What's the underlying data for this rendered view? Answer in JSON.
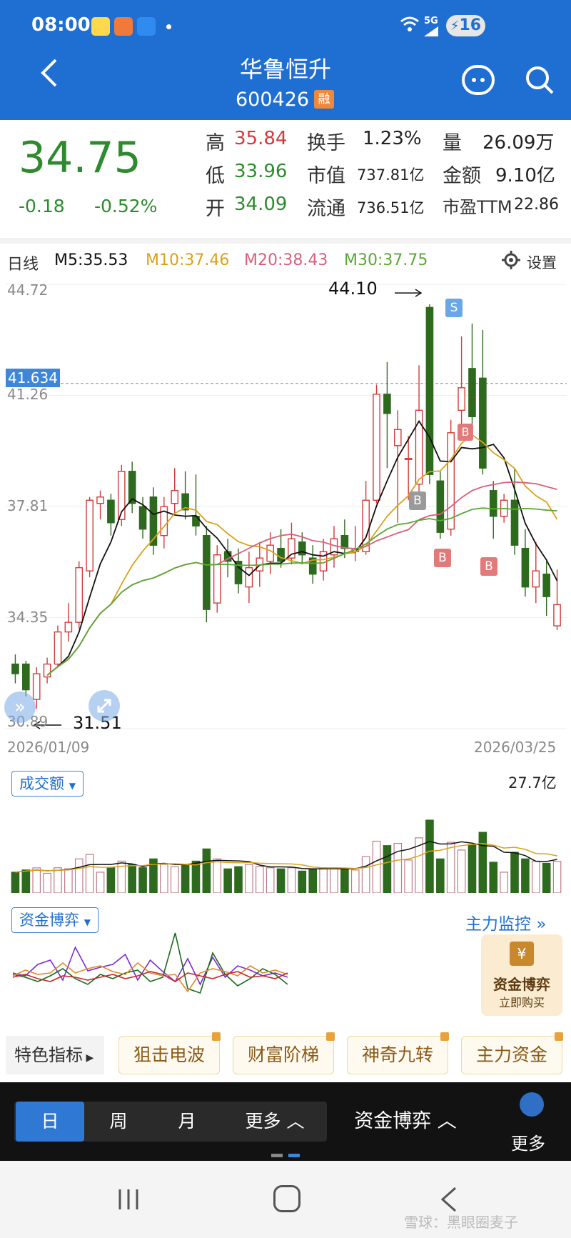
{
  "status_bar": {
    "time": "08:00",
    "network": "5G",
    "battery": "16"
  },
  "header": {
    "title": "华鲁恒升",
    "code": "600426",
    "badge": "融"
  },
  "quote": {
    "price": "34.75",
    "change": "-0.18",
    "change_pct": "-0.52%",
    "high_label": "高",
    "high": "35.84",
    "low_label": "低",
    "low": "33.96",
    "open_label": "开",
    "open": "34.09",
    "turnover_label": "换手",
    "turnover": "1.23%",
    "mktcap_label": "市值",
    "mktcap": "737.81亿",
    "float_label": "流通",
    "float": "736.51亿",
    "volume_label": "量",
    "volume": "26.09万",
    "amount_label": "金额",
    "amount": "9.10亿",
    "pe_label": "市盈TTM",
    "pe": "22.86"
  },
  "ma_legend": {
    "period": "日线",
    "m5": "M5:35.53",
    "m10": "M10:37.46",
    "m20": "M20:38.43",
    "m30": "M30:37.75",
    "settings": "设置"
  },
  "colors": {
    "up": "#d23b3b",
    "down": "#2e6a1e",
    "m5": "#111111",
    "m10": "#d9a21a",
    "m20": "#d9607a",
    "m30": "#5aa834",
    "accent": "#1f6fd2"
  },
  "price_axis": {
    "top": "44.72",
    "mid1": "41.26",
    "mid2": "37.81",
    "mid3": "34.35",
    "bottom": "30.89"
  },
  "crosshair_value": "41.634",
  "annotations": {
    "high": "44.10",
    "low": "31.51"
  },
  "signals": {
    "s": "S",
    "b": "B"
  },
  "dates": {
    "start": "2026/01/09",
    "end": "2026/03/25"
  },
  "volume_panel": {
    "selector": "成交额",
    "max": "27.7亿"
  },
  "flow_panel": {
    "selector": "资金博弈",
    "link": "主力监控",
    "promo_title": "资金博弈",
    "promo_cta": "立即购买"
  },
  "indicators": {
    "label": "特色指标",
    "items": [
      "狙击电波",
      "财富阶梯",
      "神奇九转",
      "主力资金"
    ]
  },
  "bottom_tabs": {
    "day": "日",
    "week": "周",
    "month": "月",
    "more": "更多",
    "flow": "资金博弈",
    "menu_more": "更多"
  },
  "watermark": "雪球：黑眼圈麦子",
  "chart_data": {
    "type": "candlestick",
    "ylim": [
      30.89,
      44.72
    ],
    "candles": [
      {
        "o": 32.9,
        "c": 32.6,
        "h": 33.2,
        "l": 32.3
      },
      {
        "o": 32.9,
        "c": 32.1,
        "h": 33.0,
        "l": 31.9
      },
      {
        "o": 31.8,
        "c": 32.6,
        "h": 32.8,
        "l": 31.51
      },
      {
        "o": 32.5,
        "c": 32.9,
        "h": 33.1,
        "l": 32.3
      },
      {
        "o": 32.9,
        "c": 33.9,
        "h": 34.1,
        "l": 32.8
      },
      {
        "o": 33.9,
        "c": 34.2,
        "h": 34.8,
        "l": 33.6
      },
      {
        "o": 34.2,
        "c": 35.9,
        "h": 36.1,
        "l": 34.0
      },
      {
        "o": 35.8,
        "c": 38.0,
        "h": 38.1,
        "l": 35.6
      },
      {
        "o": 37.9,
        "c": 38.1,
        "h": 38.3,
        "l": 37.4
      },
      {
        "o": 38.0,
        "c": 37.3,
        "h": 38.2,
        "l": 36.9
      },
      {
        "o": 37.4,
        "c": 38.9,
        "h": 39.1,
        "l": 37.2
      },
      {
        "o": 38.9,
        "c": 37.9,
        "h": 39.2,
        "l": 37.6
      },
      {
        "o": 37.8,
        "c": 37.1,
        "h": 38.1,
        "l": 36.8
      },
      {
        "o": 38.1,
        "c": 36.6,
        "h": 38.4,
        "l": 36.3
      },
      {
        "o": 36.9,
        "c": 37.8,
        "h": 38.1,
        "l": 36.5
      },
      {
        "o": 37.9,
        "c": 38.3,
        "h": 39.0,
        "l": 37.6
      },
      {
        "o": 38.2,
        "c": 37.7,
        "h": 38.9,
        "l": 37.4
      },
      {
        "o": 37.5,
        "c": 37.2,
        "h": 38.8,
        "l": 36.9
      },
      {
        "o": 36.9,
        "c": 34.6,
        "h": 37.2,
        "l": 34.2
      },
      {
        "o": 34.8,
        "c": 36.3,
        "h": 36.6,
        "l": 34.5
      },
      {
        "o": 36.4,
        "c": 36.1,
        "h": 36.8,
        "l": 35.6
      },
      {
        "o": 36.1,
        "c": 35.4,
        "h": 36.5,
        "l": 35.1
      },
      {
        "o": 35.3,
        "c": 35.9,
        "h": 36.4,
        "l": 34.8
      },
      {
        "o": 35.8,
        "c": 36.2,
        "h": 36.7,
        "l": 35.3
      },
      {
        "o": 36.1,
        "c": 36.6,
        "h": 37.0,
        "l": 35.7
      },
      {
        "o": 36.5,
        "c": 36.1,
        "h": 37.1,
        "l": 35.9
      },
      {
        "o": 36.2,
        "c": 36.8,
        "h": 37.3,
        "l": 36.0
      },
      {
        "o": 36.7,
        "c": 36.3,
        "h": 37.0,
        "l": 36.0
      },
      {
        "o": 36.2,
        "c": 35.7,
        "h": 36.6,
        "l": 35.4
      },
      {
        "o": 35.8,
        "c": 36.4,
        "h": 36.8,
        "l": 35.5
      },
      {
        "o": 36.3,
        "c": 36.8,
        "h": 37.2,
        "l": 35.9
      },
      {
        "o": 36.9,
        "c": 36.5,
        "h": 37.4,
        "l": 36.2
      },
      {
        "o": 36.4,
        "c": 36.5,
        "h": 37.2,
        "l": 36.1
      },
      {
        "o": 36.4,
        "c": 38.0,
        "h": 38.6,
        "l": 36.3
      },
      {
        "o": 38.0,
        "c": 41.3,
        "h": 41.6,
        "l": 37.9
      },
      {
        "o": 41.3,
        "c": 40.7,
        "h": 42.3,
        "l": 39.0
      },
      {
        "o": 39.7,
        "c": 40.2,
        "h": 40.8,
        "l": 37.3
      },
      {
        "o": 39.3,
        "c": 39.3,
        "h": 40.0,
        "l": 38.0
      },
      {
        "o": 38.5,
        "c": 40.8,
        "h": 42.2,
        "l": 38.2
      },
      {
        "o": 44.0,
        "c": 38.8,
        "h": 44.1,
        "l": 38.5
      },
      {
        "o": 38.6,
        "c": 37.0,
        "h": 38.9,
        "l": 36.8
      },
      {
        "o": 37.1,
        "c": 40.1,
        "h": 40.5,
        "l": 36.9
      },
      {
        "o": 40.8,
        "c": 41.5,
        "h": 43.1,
        "l": 40.2
      },
      {
        "o": 42.1,
        "c": 40.6,
        "h": 43.5,
        "l": 40.1
      },
      {
        "o": 41.8,
        "c": 39.0,
        "h": 43.3,
        "l": 38.8
      },
      {
        "o": 38.3,
        "c": 37.5,
        "h": 38.6,
        "l": 36.8
      },
      {
        "o": 37.5,
        "c": 38.0,
        "h": 38.2,
        "l": 37.3
      },
      {
        "o": 38.0,
        "c": 36.6,
        "h": 39.0,
        "l": 36.3
      },
      {
        "o": 36.5,
        "c": 35.3,
        "h": 37.1,
        "l": 35.0
      },
      {
        "o": 35.3,
        "c": 35.8,
        "h": 36.7,
        "l": 34.8
      },
      {
        "o": 35.7,
        "c": 35.0,
        "h": 36.1,
        "l": 34.4
      },
      {
        "o": 34.09,
        "c": 34.75,
        "h": 35.84,
        "l": 33.96
      }
    ]
  }
}
